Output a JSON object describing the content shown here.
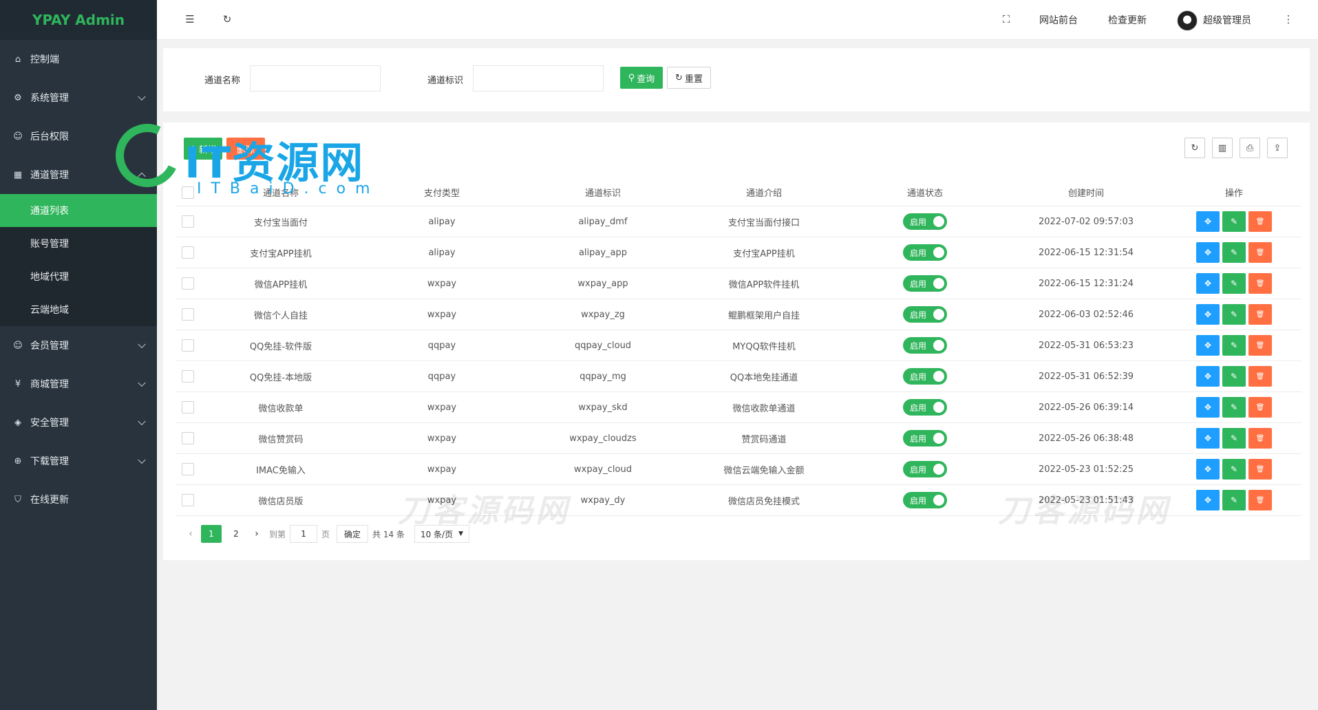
{
  "brand": "YPAY Admin",
  "sidebar": {
    "items": [
      {
        "label": "控制端",
        "icon": "home-icon"
      },
      {
        "label": "系统管理",
        "icon": "gear-icon"
      },
      {
        "label": "后台权限",
        "icon": "user-icon"
      },
      {
        "label": "通道管理",
        "icon": "apps-icon"
      },
      {
        "label": "会员管理",
        "icon": "user-icon"
      },
      {
        "label": "商城管理",
        "icon": "yen-icon"
      },
      {
        "label": "安全管理",
        "icon": "diamond-icon"
      },
      {
        "label": "下载管理",
        "icon": "download-icon"
      },
      {
        "label": "在线更新",
        "icon": "shield-icon"
      }
    ],
    "submenu": [
      "通道列表",
      "账号管理",
      "地域代理",
      "云端地域"
    ],
    "active_sub": "通道列表"
  },
  "topbar": {
    "links": [
      "网站前台",
      "检查更新"
    ],
    "user": "超级管理员"
  },
  "search": {
    "label_name": "通道名称",
    "label_code": "通道标识",
    "name_value": "",
    "code_value": "",
    "query_label": "查询",
    "reset_label": "重置"
  },
  "toolbar": {
    "add_label": "新增",
    "delete_label": "删除"
  },
  "table": {
    "columns": [
      "通道名称",
      "支付类型",
      "通道标识",
      "通道介绍",
      "通道状态",
      "创建时间",
      "操作"
    ],
    "status_label": "启用",
    "rows": [
      {
        "name": "支付宝当面付",
        "type": "alipay",
        "code": "alipay_dmf",
        "desc": "支付宝当面付接口",
        "created": "2022-07-02 09:57:03"
      },
      {
        "name": "支付宝APP挂机",
        "type": "alipay",
        "code": "alipay_app",
        "desc": "支付宝APP挂机",
        "created": "2022-06-15 12:31:54"
      },
      {
        "name": "微信APP挂机",
        "type": "wxpay",
        "code": "wxpay_app",
        "desc": "微信APP软件挂机",
        "created": "2022-06-15 12:31:24"
      },
      {
        "name": "微信个人自挂",
        "type": "wxpay",
        "code": "wxpay_zg",
        "desc": "鲲鹏框架用户自挂",
        "created": "2022-06-03 02:52:46"
      },
      {
        "name": "QQ免挂-软件版",
        "type": "qqpay",
        "code": "qqpay_cloud",
        "desc": "MYQQ软件挂机",
        "created": "2022-05-31 06:53:23"
      },
      {
        "name": "QQ免挂-本地版",
        "type": "qqpay",
        "code": "qqpay_mg",
        "desc": "QQ本地免挂通道",
        "created": "2022-05-31 06:52:39"
      },
      {
        "name": "微信收款单",
        "type": "wxpay",
        "code": "wxpay_skd",
        "desc": "微信收款单通道",
        "created": "2022-05-26 06:39:14"
      },
      {
        "name": "微信赞赏码",
        "type": "wxpay",
        "code": "wxpay_cloudzs",
        "desc": "赞赏码通道",
        "created": "2022-05-26 06:38:48"
      },
      {
        "name": "IMAC免输入",
        "type": "wxpay",
        "code": "wxpay_cloud",
        "desc": "微信云端免输入金额",
        "created": "2022-05-23 01:52:25"
      },
      {
        "name": "微信店员版",
        "type": "wxpay",
        "code": "wxpay_dy",
        "desc": "微信店员免挂模式",
        "created": "2022-05-23 01:51:43"
      }
    ]
  },
  "pagination": {
    "pages": [
      "1",
      "2"
    ],
    "current": "1",
    "goto_label": "到第",
    "goto_value": "1",
    "page_label": "页",
    "confirm_label": "确定",
    "total_label": "共 14 条",
    "size_label": "10 条/页"
  },
  "watermark": {
    "logo_text": "IT资源网",
    "logo_sub": "ITBaiD.com",
    "text_1": "刀客源码网",
    "text_2": "刀客源码网"
  },
  "colors": {
    "accent": "#2fb55b",
    "sidebar_bg": "#28333e",
    "move": "#1e9fff",
    "delete": "#ff5722"
  }
}
